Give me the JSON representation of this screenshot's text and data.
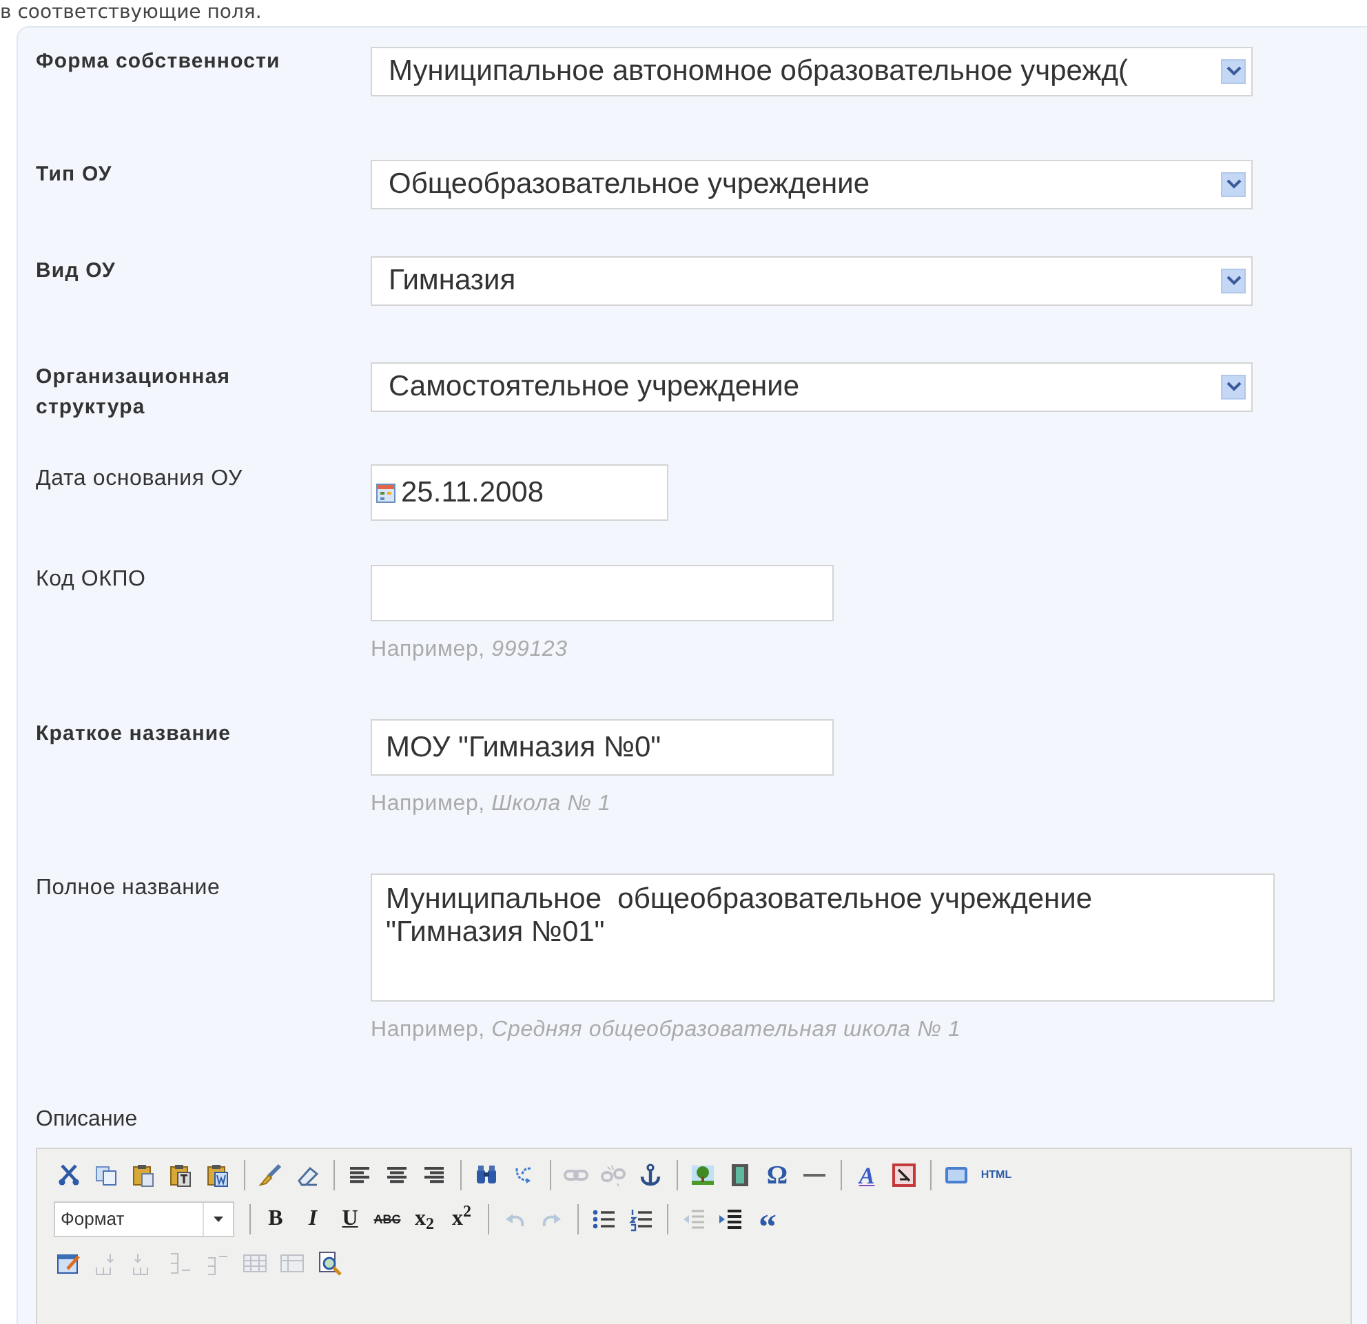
{
  "intro_text": "в соответствующие поля.",
  "fields": [
    {
      "label": "Форма собственности",
      "emphasized": true,
      "kind": "select",
      "value": "Муниципальное автономное образовательное учрежд("
    },
    {
      "label": "Тип ОУ",
      "emphasized": true,
      "kind": "select",
      "value": "Общеобразовательное учреждение"
    },
    {
      "label": "Вид ОУ",
      "emphasized": true,
      "kind": "select",
      "value": "Гимназия"
    },
    {
      "label": "Организационная структура",
      "emphasized": true,
      "kind": "select",
      "value": "Самостоятельное учреждение"
    },
    {
      "label": "Дата основания ОУ",
      "emphasized": false,
      "kind": "date",
      "value": "25.11.2008"
    },
    {
      "label": "Код ОКПО",
      "emphasized": false,
      "kind": "text",
      "hint": "Например, *999123*"
    },
    {
      "label": "Краткое название",
      "emphasized": true,
      "kind": "text",
      "value": "МОУ \"Гимназия №0\"",
      "hint": "Например, *Школа № 1*"
    },
    {
      "label": "Полное название",
      "emphasized": false,
      "kind": "textarea",
      "value": "Муниципальное  общеобразовательное учреждение \"Гимназия №01\"",
      "hint": "Например, *Средняя общеобразовательная школа № 1*"
    }
  ],
  "description_label": "Описание",
  "editor_toolbar": {
    "rows": [
      [
        {
          "kind": "button",
          "disabled": false
        },
        {
          "kind": "button",
          "disabled": false
        },
        {
          "kind": "button",
          "disabled": false
        },
        {
          "kind": "button",
          "disabled": false
        },
        {
          "kind": "button",
          "disabled": false
        },
        {
          "kind": "separator"
        },
        {
          "kind": "button",
          "disabled": false
        },
        {
          "kind": "button",
          "disabled": false
        },
        {
          "kind": "separator"
        },
        {
          "kind": "button",
          "disabled": false
        },
        {
          "kind": "button",
          "disabled": false
        },
        {
          "kind": "button",
          "disabled": false
        },
        {
          "kind": "separator"
        },
        {
          "kind": "button",
          "disabled": false
        },
        {
          "kind": "button",
          "disabled": false
        },
        {
          "kind": "separator"
        },
        {
          "kind": "button",
          "disabled": true
        },
        {
          "kind": "button",
          "disabled": true
        },
        {
          "kind": "button",
          "disabled": false
        },
        {
          "kind": "separator"
        },
        {
          "kind": "button",
          "disabled": false
        },
        {
          "kind": "button",
          "disabled": false
        },
        {
          "kind": "glyph",
          "text": "Ω",
          "disabled": false
        },
        {
          "kind": "button",
          "disabled": false
        },
        {
          "kind": "separator"
        },
        {
          "kind": "glyph",
          "text": "A",
          "disabled": false
        },
        {
          "kind": "button",
          "disabled": false
        },
        {
          "kind": "separator"
        },
        {
          "kind": "button",
          "disabled": false
        },
        {
          "kind": "glyph",
          "text": "HTML",
          "disabled": false
        }
      ],
      [
        {
          "kind": "combo",
          "value": "Формат"
        },
        {
          "kind": "separator"
        },
        {
          "kind": "glyph",
          "text": "B",
          "disabled": false
        },
        {
          "kind": "glyph",
          "text": "I",
          "disabled": false
        },
        {
          "kind": "glyph",
          "text": "U",
          "disabled": false
        },
        {
          "kind": "glyph",
          "text": "ABC",
          "disabled": false
        },
        {
          "kind": "glyph",
          "text": "x$_{2}$",
          "disabled": false
        },
        {
          "kind": "glyph",
          "text": "x$^{2}$",
          "disabled": false
        },
        {
          "kind": "separator"
        },
        {
          "kind": "button",
          "disabled": true
        },
        {
          "kind": "button",
          "disabled": true
        },
        {
          "kind": "separator"
        },
        {
          "kind": "button",
          "disabled": false
        },
        {
          "kind": "button",
          "disabled": false
        },
        {
          "kind": "separator"
        },
        {
          "kind": "button",
          "disabled": true
        },
        {
          "kind": "button",
          "disabled": false
        },
        {
          "kind": "glyph",
          "text": "“",
          "disabled": false
        }
      ],
      [
        {
          "kind": "button",
          "disabled": false
        },
        {
          "kind": "button",
          "disabled": true
        },
        {
          "kind": "button",
          "disabled": true
        },
        {
          "kind": "button",
          "disabled": true
        },
        {
          "kind": "button",
          "disabled": true
        },
        {
          "kind": "button",
          "disabled": true
        },
        {
          "kind": "button",
          "disabled": true
        },
        {
          "kind": "button",
          "disabled": false
        }
      ]
    ]
  }
}
